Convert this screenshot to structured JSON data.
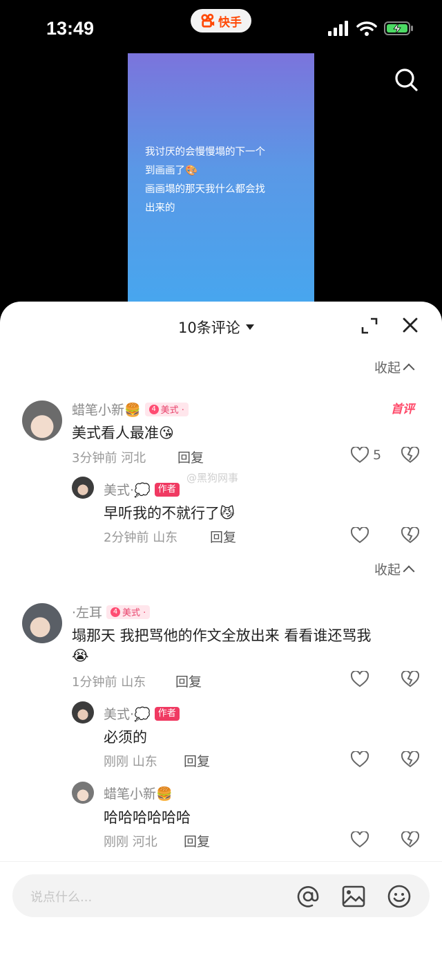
{
  "status_bar": {
    "time": "13:49",
    "app_name": "快手"
  },
  "video": {
    "caption": "我讨厌的会慢慢塌的下一个\n到画画了🎨\n画画塌的那天我什么都会找\n出来的"
  },
  "sheet": {
    "comment_count": "10条评论",
    "collapse_label": "收起",
    "watermark": "@黑狗网事"
  },
  "comments": [
    {
      "name": "蜡笔小新🍔",
      "badge": "美式 ·",
      "badge_num": "4",
      "tag": "首评",
      "text": "美式看人最准😘",
      "time": "3分钟前",
      "location": "河北",
      "reply_label": "回复",
      "likes": "5",
      "replies": [
        {
          "name": "美式·💭",
          "role_badge": "作者",
          "text": "早听我的不就行了😼",
          "time": "2分钟前",
          "location": "山东",
          "reply_label": "回复"
        }
      ]
    },
    {
      "name": "·左耳",
      "badge": "美式 ·",
      "badge_num": "4",
      "text_line1": "塌那天 我把骂他的作文全放出来 看看谁还骂我",
      "text_line2": "😭",
      "time": "1分钟前",
      "location": "山东",
      "reply_label": "回复",
      "replies": [
        {
          "name": "美式·💭",
          "role_badge": "作者",
          "text": "必须的",
          "time": "刚刚",
          "location": "山东",
          "reply_label": "回复"
        },
        {
          "name": "蜡笔小新🍔",
          "text": "哈哈哈哈哈哈",
          "time": "刚刚",
          "location": "河北",
          "reply_label": "回复"
        }
      ]
    }
  ],
  "input": {
    "placeholder": "说点什么..."
  },
  "colors": {
    "accent": "#ff4906",
    "badge_pink": "#f03a62",
    "tag_red": "#ff4a6a"
  }
}
